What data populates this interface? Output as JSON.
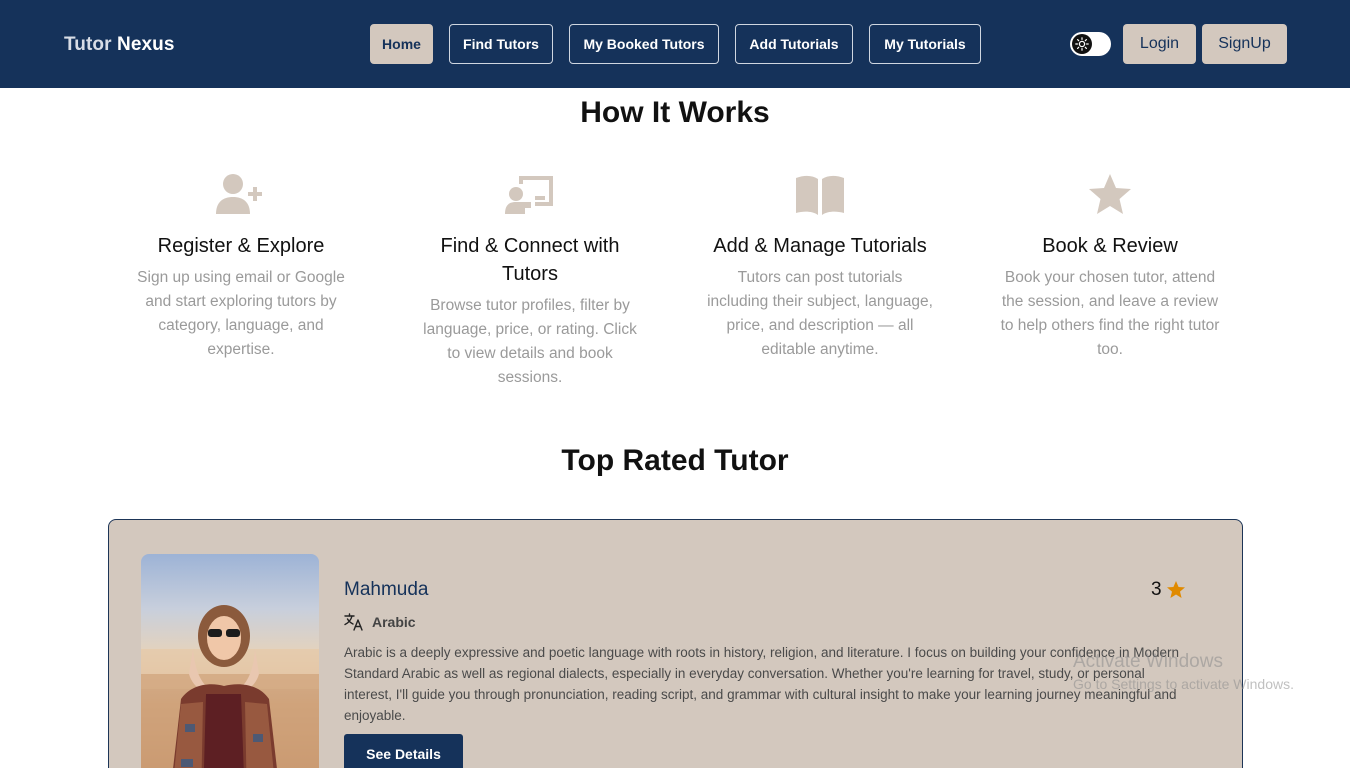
{
  "brand": {
    "part1": "Tutor",
    "part2": "Nexus"
  },
  "nav": {
    "items": [
      {
        "label": "Home",
        "active": true
      },
      {
        "label": "Find Tutors",
        "active": false
      },
      {
        "label": "My Booked Tutors",
        "active": false
      },
      {
        "label": "Add Tutorials",
        "active": false
      },
      {
        "label": "My Tutorials",
        "active": false
      }
    ],
    "theme_toggle_icon": "sun-icon",
    "login_label": "Login",
    "signup_label": "SignUp"
  },
  "how_it_works": {
    "title": "How It Works",
    "steps": [
      {
        "icon": "user-plus-icon",
        "title": "Register & Explore",
        "description": "Sign up using email or Google and start exploring tutors by category, language, and expertise."
      },
      {
        "icon": "chalkboard-teacher-icon",
        "title": "Find & Connect with Tutors",
        "description": "Browse tutor profiles, filter by language, price, or rating. Click to view details and book sessions."
      },
      {
        "icon": "open-book-icon",
        "title": "Add & Manage Tutorials",
        "description": "Tutors can post tutorials including their subject, language, price, and description — all editable anytime."
      },
      {
        "icon": "star-icon",
        "title": "Book & Review",
        "description": "Book your chosen tutor, attend the session, and leave a review to help others find the right tutor too."
      }
    ]
  },
  "top_rated": {
    "title": "Top Rated Tutor",
    "tutor": {
      "name": "Mahmuda",
      "rating": "3",
      "language": "Arabic",
      "description": "Arabic is a deeply expressive and poetic language with roots in history, religion, and literature. I focus on building your confidence in Modern Standard Arabic as well as regional dialects, especially in everyday conversation. Whether you're learning for travel, study, or personal interest, I'll guide you through pronunciation, reading script, and grammar with cultural insight to make your learning journey meaningful and enjoyable.",
      "button_label": "See Details"
    }
  },
  "watermark": {
    "line1": "Activate Windows",
    "line2": "Go to Settings to activate Windows."
  },
  "colors": {
    "navbar": "#15325a",
    "accent_beige": "#d3c8be",
    "icon_beige": "#d3c8be",
    "star": "#e08a00"
  }
}
